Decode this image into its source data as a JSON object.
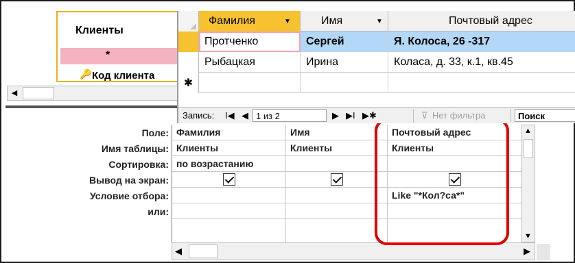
{
  "design_table": {
    "title": "Клиенты",
    "all_fields": "*",
    "field": "Код клиента"
  },
  "scroll_arrows": {
    "left": "◀",
    "right": "▶",
    "up": "▲",
    "down": "▼"
  },
  "grid_labels": {
    "field": "Поле:",
    "table": "Имя таблицы:",
    "sort": "Сортировка:",
    "show": "Вывод на экран:",
    "criteria": "Условие отбора:",
    "or": "или:"
  },
  "grid_columns": [
    {
      "field": "Фамилия",
      "table": "Клиенты",
      "sort": "по возрастанию",
      "show": true,
      "criteria": ""
    },
    {
      "field": "Имя",
      "table": "Клиенты",
      "sort": "",
      "show": true,
      "criteria": ""
    },
    {
      "field": "Почтовый адрес",
      "table": "Клиенты",
      "sort": "",
      "show": true,
      "criteria": "Like \"*Кол?са*\""
    }
  ],
  "datasheet": {
    "headers": [
      "Фамилия",
      "Имя",
      "Почтовый адрес"
    ],
    "rows": [
      [
        "Протченко",
        "Сергей",
        "Я. Колоса, 26 -317"
      ],
      [
        "Рыбацкая",
        "Ирина",
        "Коласа, д. 33, к.1, кв.45"
      ]
    ],
    "new_row_marker": "✱",
    "navigation": {
      "label": "Запись:",
      "first": "I◀",
      "prev": "◀",
      "current": "1 из 2",
      "next": "▶",
      "last": "▶I",
      "new": "▶✱",
      "filter": "Нет фильтра",
      "search": "Поиск"
    }
  },
  "colors": {
    "selected_column": "#f7c22f",
    "highlight_row": "#b3d7f6",
    "annotation": "#e00000"
  }
}
